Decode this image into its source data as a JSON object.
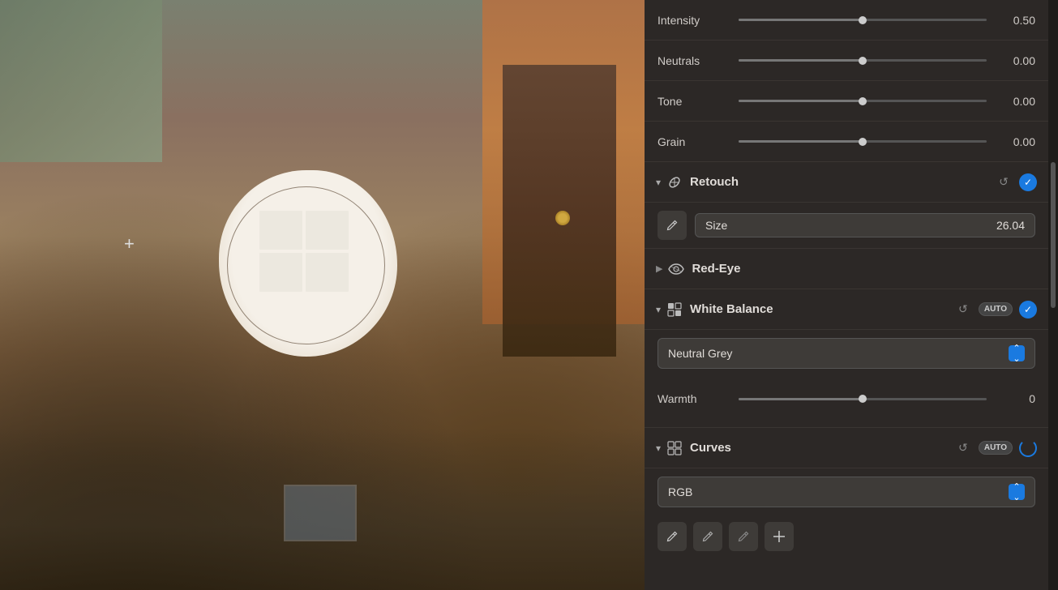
{
  "image": {
    "alt": "Building photo with retouch circle overlay"
  },
  "panel": {
    "sliders": [
      {
        "id": "intensity",
        "label": "Intensity",
        "value": "0.50",
        "fill_pct": 50,
        "thumb_pct": 50
      },
      {
        "id": "neutrals",
        "label": "Neutrals",
        "value": "0.00",
        "fill_pct": 50,
        "thumb_pct": 50
      },
      {
        "id": "tone",
        "label": "Tone",
        "value": "0.00",
        "fill_pct": 50,
        "thumb_pct": 50
      },
      {
        "id": "grain",
        "label": "Grain",
        "value": "0.00",
        "fill_pct": 50,
        "thumb_pct": 50
      }
    ],
    "retouch": {
      "title": "Retouch",
      "size_label": "Size",
      "size_value": "26.04",
      "has_reset": true,
      "has_check": true
    },
    "redeye": {
      "title": "Red-Eye"
    },
    "white_balance": {
      "title": "White Balance",
      "preset": "Neutral Grey",
      "has_reset": true,
      "has_auto": true,
      "has_check": true,
      "warmth_label": "Warmth",
      "warmth_value": "0"
    },
    "curves": {
      "title": "Curves",
      "channel": "RGB",
      "has_reset": true,
      "has_auto": true
    }
  }
}
